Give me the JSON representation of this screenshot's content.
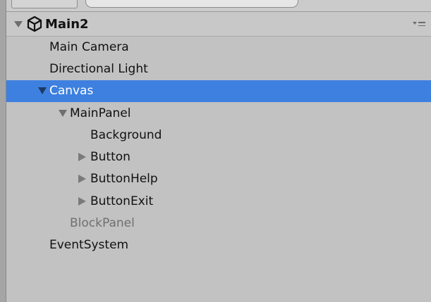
{
  "scene": {
    "name": "Main2",
    "icon": "unity-scene-icon",
    "menu_icon": "hierarchy-menu-icon"
  },
  "hierarchy": [
    {
      "label": "Main Camera",
      "depth": 0,
      "expander": "none",
      "selected": false,
      "inactive": false
    },
    {
      "label": "Directional Light",
      "depth": 0,
      "expander": "none",
      "selected": false,
      "inactive": false
    },
    {
      "label": "Canvas",
      "depth": 0,
      "expander": "expanded",
      "selected": true,
      "inactive": false
    },
    {
      "label": "MainPanel",
      "depth": 1,
      "expander": "expanded",
      "selected": false,
      "inactive": false
    },
    {
      "label": "Background",
      "depth": 2,
      "expander": "none",
      "selected": false,
      "inactive": false
    },
    {
      "label": "Button",
      "depth": 2,
      "expander": "collapsed",
      "selected": false,
      "inactive": false
    },
    {
      "label": "ButtonHelp",
      "depth": 2,
      "expander": "collapsed",
      "selected": false,
      "inactive": false
    },
    {
      "label": "ButtonExit",
      "depth": 2,
      "expander": "collapsed",
      "selected": false,
      "inactive": false
    },
    {
      "label": "BlockPanel",
      "depth": 1,
      "expander": "none",
      "selected": false,
      "inactive": true
    },
    {
      "label": "EventSystem",
      "depth": 0,
      "expander": "none",
      "selected": false,
      "inactive": false
    }
  ],
  "colors": {
    "background": "#c2c2c2",
    "selection": "#3d80df",
    "text": "#111111",
    "inactive_text": "#707070"
  }
}
